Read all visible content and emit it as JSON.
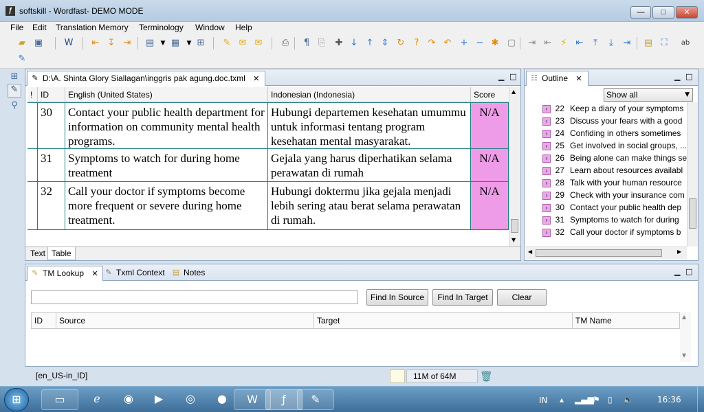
{
  "window": {
    "title": "softskill - Wordfast- DEMO MODE",
    "minimize_glyph": "—",
    "maximize_glyph": "□",
    "close_glyph": "✕"
  },
  "menu": [
    "File",
    "Edit",
    "Translation Memory",
    "Terminology",
    "Window",
    "Help"
  ],
  "editor": {
    "tab_title": "D:\\A. Shinta Glory Siallagan\\inggris pak agung.doc.txml",
    "columns": {
      "flag": "!",
      "id": "ID",
      "source": "English (United States)",
      "target": "Indonesian (Indonesia)",
      "score": "Score"
    },
    "rows": [
      {
        "id": "30",
        "source": "Contact your public health department for information on community mental health programs.",
        "target": "Hubungi departemen kesehatan umummu untuk informasi tentang program kesehatan mental masyarakat.",
        "score": "N/A"
      },
      {
        "id": "31",
        "source": "Symptoms to watch for during home treatment",
        "target": "Gejala yang harus diperhatikan selama perawatan di rumah",
        "score": "N/A"
      },
      {
        "id": "32",
        "source": "Call your doctor if symptoms become more frequent or severe during home treatment.",
        "target": "Hubungi doktermu jika gejala menjadi lebih sering atau berat selama perawatan di rumah.",
        "score": "N/A"
      }
    ],
    "bottom_tabs": [
      "Text",
      "Table"
    ]
  },
  "outline": {
    "tab_title": "Outline",
    "filter": "Show all",
    "items": [
      {
        "num": "22",
        "text": "Keep a diary of your symptoms"
      },
      {
        "num": "23",
        "text": "Discuss your fears with a good"
      },
      {
        "num": "24",
        "text": "Confiding in others sometimes"
      },
      {
        "num": "25",
        "text": "Get involved in social groups, ..."
      },
      {
        "num": "26",
        "text": "Being alone can make things se"
      },
      {
        "num": "27",
        "text": "Learn about resources availabl"
      },
      {
        "num": "28",
        "text": "Talk with your human resource"
      },
      {
        "num": "29",
        "text": "Check with your insurance com"
      },
      {
        "num": "30",
        "text": "Contact your public health dep"
      },
      {
        "num": "31",
        "text": "Symptoms to watch for during"
      },
      {
        "num": "32",
        "text": "Call your doctor if symptoms b"
      }
    ]
  },
  "tm_panel": {
    "tabs": [
      "TM Lookup",
      "Txml Context",
      "Notes"
    ],
    "search_value": "",
    "buttons": {
      "find_source": "Find In Source",
      "find_target": "Find In Target",
      "clear": "Clear"
    },
    "columns": {
      "id": "ID",
      "source": "Source",
      "target": "Target",
      "tm_name": "TM Name"
    }
  },
  "status": {
    "locale": "[en_US-in_ID]",
    "memory": "11M of 64M"
  },
  "taskbar": {
    "lang": "IN",
    "time": "16:36"
  }
}
